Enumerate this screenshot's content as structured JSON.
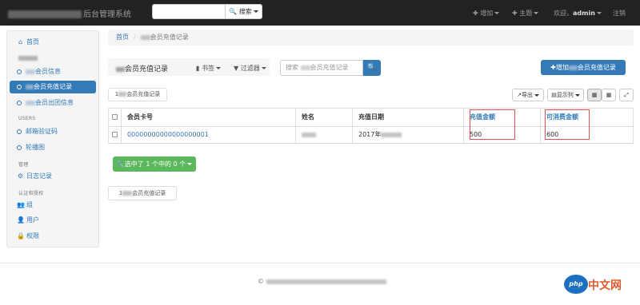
{
  "navbar": {
    "brand_suffix": "后台管理系统",
    "search_button": "搜索",
    "add_menu": "增加",
    "theme_menu": "主题",
    "welcome_prefix": "欢迎，",
    "username": "admin",
    "logout": "注销"
  },
  "sidebar": {
    "home": "首页",
    "member_info": "会员信息",
    "recharge_record": "会员充值记录",
    "group_info": "会员出团信息",
    "head_users": "USERS",
    "email_code": "邮箱验证码",
    "carousel": "轮播图",
    "head_manage": "管理",
    "log_record": "日志记录",
    "head_auth": "认证和授权",
    "group": "组",
    "user": "用户",
    "permission": "权限"
  },
  "breadcrumb": {
    "home": "首页",
    "current": "会员充值记录"
  },
  "toolbar": {
    "title": "会员充值记录",
    "bookmark": "书签",
    "filter": "过滤器",
    "search_placeholder": "搜索",
    "search_placeholder_suffix": "会员充值记录",
    "add_button_prefix": "增加",
    "add_button_suffix": "会员充值记录",
    "tag_chip_suffix": "会员充值记录",
    "export": "导出",
    "columns": "显示列"
  },
  "table": {
    "headers": [
      "会员卡号",
      "姓名",
      "充值日期",
      "充值金额",
      "可消费金额"
    ],
    "rows": [
      {
        "card_no": "00000000000000000001",
        "date_prefix": "2017年",
        "amount": "500",
        "spendable": "600"
      }
    ]
  },
  "selection_button": "选中了 1 个中的 0 个",
  "bottom_tag_suffix": "会员充值记录",
  "footer": {
    "copyright_symbol": "©"
  },
  "watermark": {
    "logo": "php",
    "text": "中文网"
  },
  "colors": {
    "primary": "#337ab7",
    "success": "#5cb85c",
    "navbar": "#222222",
    "highlight_box": "#d9534f"
  }
}
